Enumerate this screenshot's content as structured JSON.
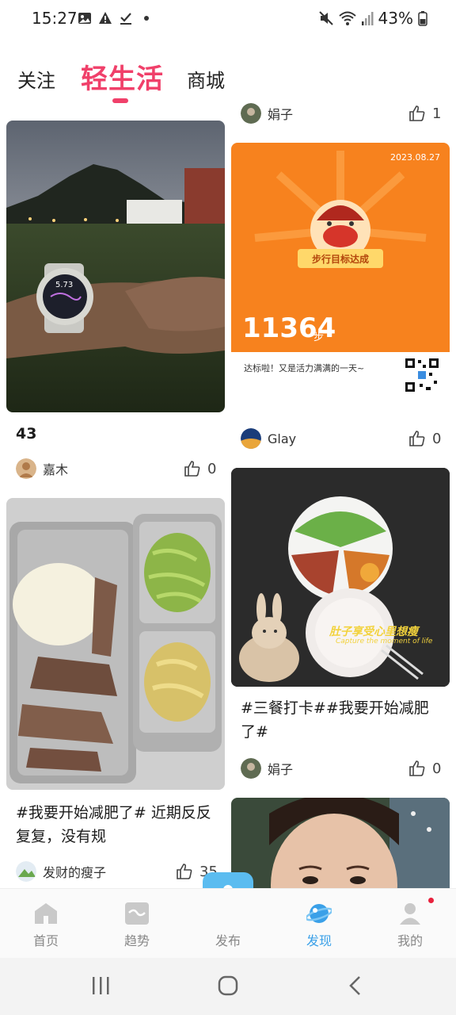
{
  "status_bar": {
    "time": "15:27",
    "battery": "43%"
  },
  "tabs": [
    {
      "label": "关注"
    },
    {
      "label": "轻生活"
    },
    {
      "label": "商城"
    }
  ],
  "feed": {
    "left": [
      {
        "title": "43",
        "author": "嘉木",
        "likes": "0"
      },
      {
        "title": "#我要开始减肥了# 近期反反复复，没有规",
        "author": "发财的瘦子",
        "likes": "35"
      }
    ],
    "right": [
      {
        "author": "娟子",
        "likes": "1"
      },
      {
        "step_card": {
          "date": "2023.08.27",
          "badge": "步行目标达成",
          "steps": "11364",
          "unit": "步",
          "caption": "达标啦！又是活力满满的一天~"
        },
        "author": "Glay",
        "likes": "0"
      },
      {
        "overlay_text": "肚子享受心里想瘦",
        "overlay_sub": "Capture the moment of life",
        "title": "#三餐打卡##我要开始减肥了#",
        "author": "娟子",
        "likes": "0"
      }
    ]
  },
  "bottom_nav": [
    {
      "label": "首页",
      "icon": "home-icon"
    },
    {
      "label": "趋势",
      "icon": "trend-icon"
    },
    {
      "label": "发布",
      "icon": "plus-icon"
    },
    {
      "label": "发现",
      "icon": "planet-icon"
    },
    {
      "label": "我的",
      "icon": "profile-icon"
    }
  ],
  "colors": {
    "accent": "#f0406a",
    "active_nav": "#3aa0e8",
    "publish": "#5bbcf0",
    "step_card": "#f7821e"
  }
}
